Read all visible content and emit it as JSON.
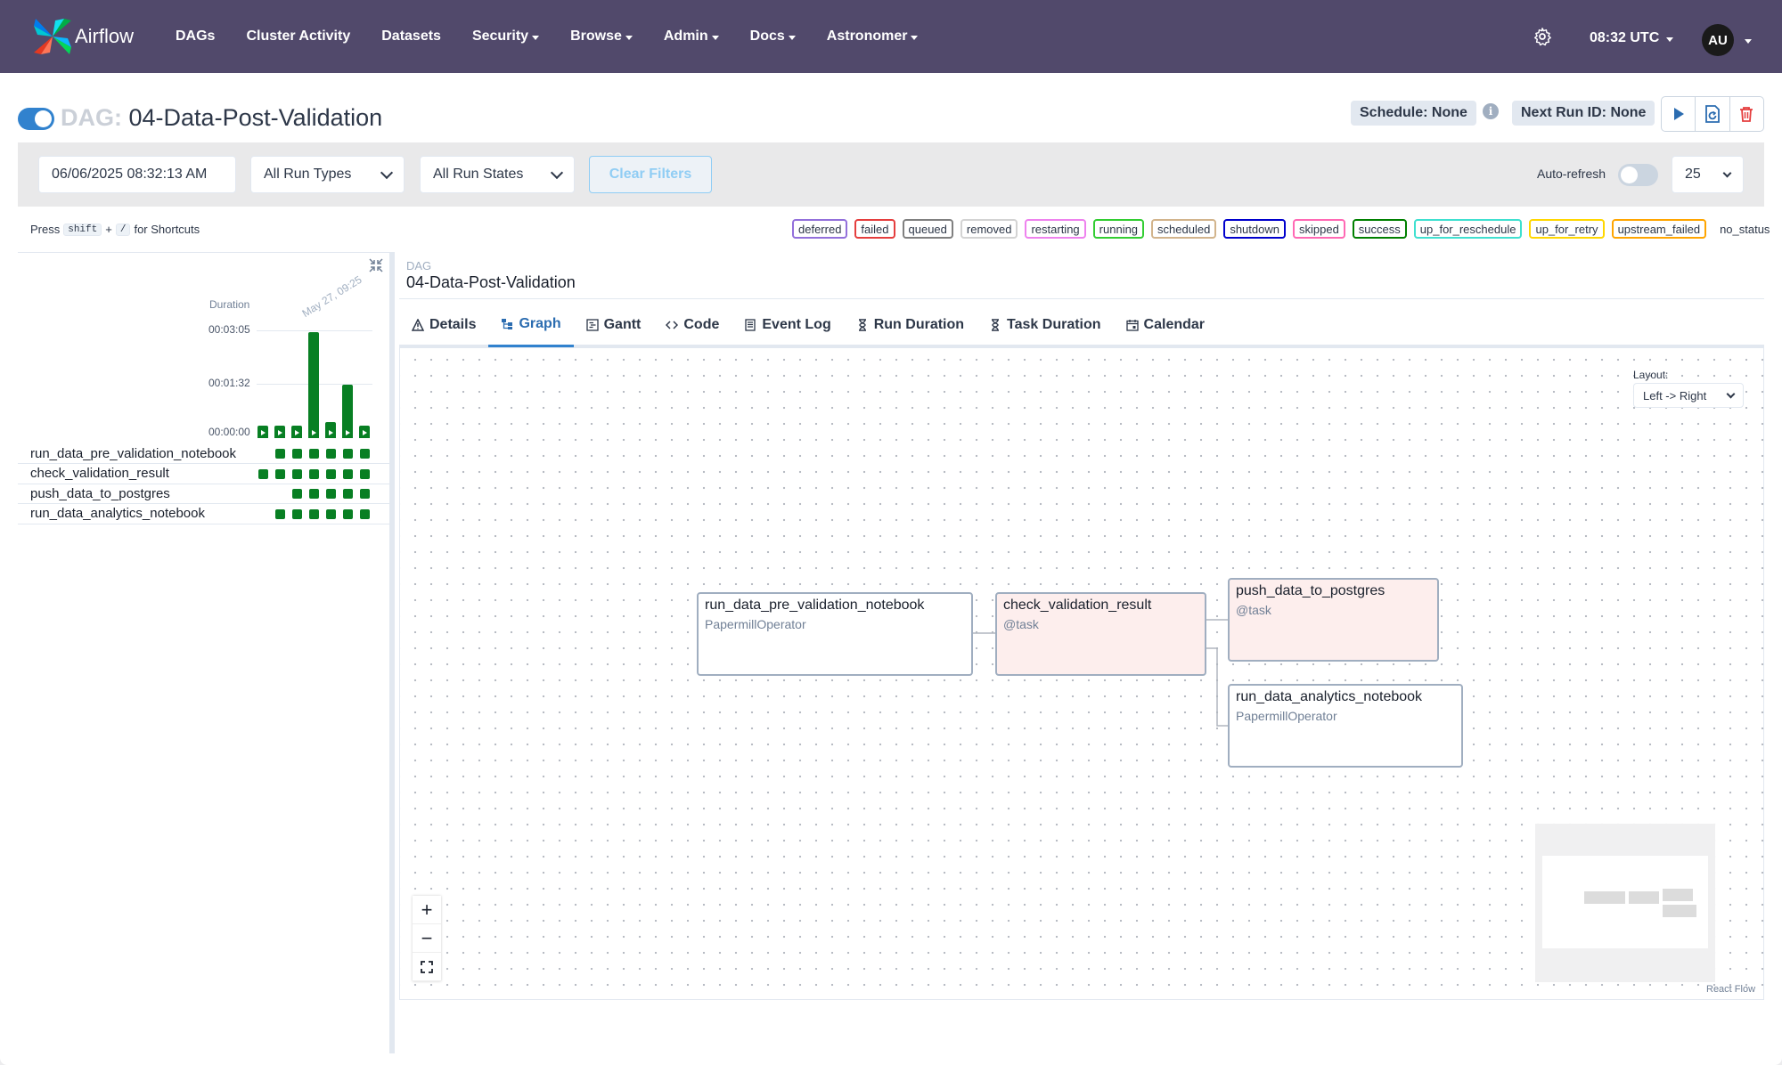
{
  "nav": {
    "brand": "Airflow",
    "items": [
      {
        "label": "DAGs",
        "caret": false
      },
      {
        "label": "Cluster Activity",
        "caret": false
      },
      {
        "label": "Datasets",
        "caret": false
      },
      {
        "label": "Security",
        "caret": true
      },
      {
        "label": "Browse",
        "caret": true
      },
      {
        "label": "Admin",
        "caret": true
      },
      {
        "label": "Docs",
        "caret": true
      },
      {
        "label": "Astronomer",
        "caret": true
      }
    ],
    "time": "08:32 UTC",
    "avatar": "AU",
    "bg_color": "#51496b"
  },
  "header": {
    "dag_prefix": "DAG:",
    "dag_name": "04-Data-Post-Validation",
    "paused": false,
    "schedule": "Schedule: None",
    "next_run": "Next Run ID: None",
    "info_icon": "i"
  },
  "filters": {
    "date": "06/06/2025  08:32:13 AM",
    "run_types": "All Run Types",
    "run_states": "All Run States",
    "clear": "Clear Filters",
    "auto_refresh": "Auto-refresh",
    "page_size": "25"
  },
  "shortcuts": {
    "press": "Press",
    "key1": "shift",
    "plus": "+",
    "key2": "/",
    "suffix": "for Shortcuts"
  },
  "legend": [
    {
      "label": "deferred",
      "color": "#9370db"
    },
    {
      "label": "failed",
      "color": "#e53e3e"
    },
    {
      "label": "queued",
      "color": "#808080"
    },
    {
      "label": "removed",
      "color": "#d3d3d3"
    },
    {
      "label": "restarting",
      "color": "#ee82ee"
    },
    {
      "label": "running",
      "color": "#32cd32"
    },
    {
      "label": "scheduled",
      "color": "#d2b48c"
    },
    {
      "label": "shutdown",
      "color": "#0000cd"
    },
    {
      "label": "skipped",
      "color": "#ff69b4"
    },
    {
      "label": "success",
      "color": "#008000"
    },
    {
      "label": "up_for_reschedule",
      "color": "#40e0d0"
    },
    {
      "label": "up_for_retry",
      "color": "#ffd700"
    },
    {
      "label": "upstream_failed",
      "color": "#ffa500"
    },
    {
      "label": "no_status",
      "color": ""
    }
  ],
  "grid": {
    "duration_label": "Duration",
    "date_label": "May 27, 09:25",
    "y_ticks": [
      "00:03:05",
      "00:01:32",
      "00:00:00"
    ],
    "run_durations_sec": [
      8,
      8,
      8,
      183,
      28,
      92,
      8
    ],
    "tasks": [
      {
        "name": "run_data_pre_validation_notebook",
        "runs": 6
      },
      {
        "name": "check_validation_result",
        "runs": 7
      },
      {
        "name": "push_data_to_postgres",
        "runs": 5
      },
      {
        "name": "run_data_analytics_notebook",
        "runs": 6
      }
    ],
    "success_color": "#087f23"
  },
  "details": {
    "dag_label": "DAG",
    "dag_name": "04-Data-Post-Validation",
    "tabs": [
      {
        "label": "Details",
        "icon": "warning-triangle-icon"
      },
      {
        "label": "Graph",
        "icon": "graph-icon"
      },
      {
        "label": "Gantt",
        "icon": "gantt-icon"
      },
      {
        "label": "Code",
        "icon": "code-icon"
      },
      {
        "label": "Event Log",
        "icon": "event-log-icon"
      },
      {
        "label": "Run Duration",
        "icon": "hourglass-icon"
      },
      {
        "label": "Task Duration",
        "icon": "hourglass-icon"
      },
      {
        "label": "Calendar",
        "icon": "calendar-icon"
      }
    ],
    "active_tab": "Graph"
  },
  "graph": {
    "layout_label": "Layout:",
    "layout_value": "Left -> Right",
    "nodes": [
      {
        "name": "run_data_pre_validation_notebook",
        "operator": "PapermillOperator"
      },
      {
        "name": "check_validation_result",
        "operator": "@task"
      },
      {
        "name": "push_data_to_postgres",
        "operator": "@task"
      },
      {
        "name": "run_data_analytics_notebook",
        "operator": "PapermillOperator"
      }
    ],
    "zoom_in": "+",
    "zoom_out": "−",
    "attribution": "React Flow"
  }
}
